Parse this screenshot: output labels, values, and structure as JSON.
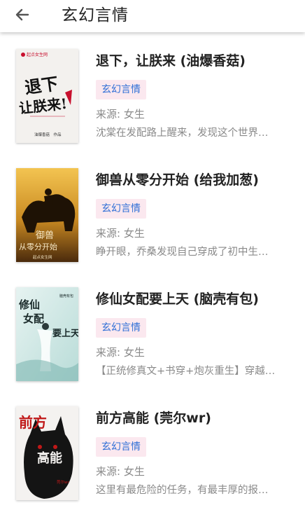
{
  "header": {
    "title": "玄幻言情",
    "back_icon": "arrow-left-icon"
  },
  "books": [
    {
      "title": "退下，让朕来 (油爆香菇)",
      "tag": "玄幻言情",
      "source": "来源: 女生",
      "description": "沈棠在发配路上醒来，发现这个世界…",
      "cover": {
        "title_lines": [
          "退下",
          "让朕来!"
        ],
        "publisher": "起点女生网",
        "author_line": "油爆香菇　作品",
        "colors": {
          "bg": "#f3f1ee",
          "ink": "#111111",
          "accent": "#c8102e"
        }
      }
    },
    {
      "title": "御兽从零分开始 (给我加葱)",
      "tag": "玄幻言情",
      "source": "来源: 女生",
      "description": "睁开眼，乔桑发现自己穿成了初中生…",
      "cover": {
        "title_lines": [
          "御兽",
          "从零分开始"
        ],
        "publisher": "起点女生网",
        "colors": {
          "sky": "#e9b23a",
          "ground": "#5b3410",
          "beast": "#1e1205",
          "text": "#f6e7c4"
        }
      }
    },
    {
      "title": "修仙女配要上天 (脑壳有包)",
      "tag": "玄幻言情",
      "source": "来源: 女生",
      "description": "【正统修真文+书穿+炮灰重生】穿越…",
      "cover": {
        "title_lines": [
          "修仙",
          "女配",
          "要上天"
        ],
        "author_line": "脑壳有包",
        "colors": {
          "bg": "#d7ebe9",
          "ink": "#1a2a2a",
          "accent": "#7fb8b2"
        }
      }
    },
    {
      "title": "前方高能 (莞尔wr)",
      "tag": "玄幻言情",
      "source": "来源: 女生",
      "description": "这里有最危险的任务，有最丰厚的报…",
      "cover": {
        "title_lines": [
          "前方",
          "高能"
        ],
        "author_line": "莞尔wr",
        "colors": {
          "bg": "#f4f2f0",
          "cat": "#141414",
          "accent": "#c01818"
        }
      }
    }
  ]
}
